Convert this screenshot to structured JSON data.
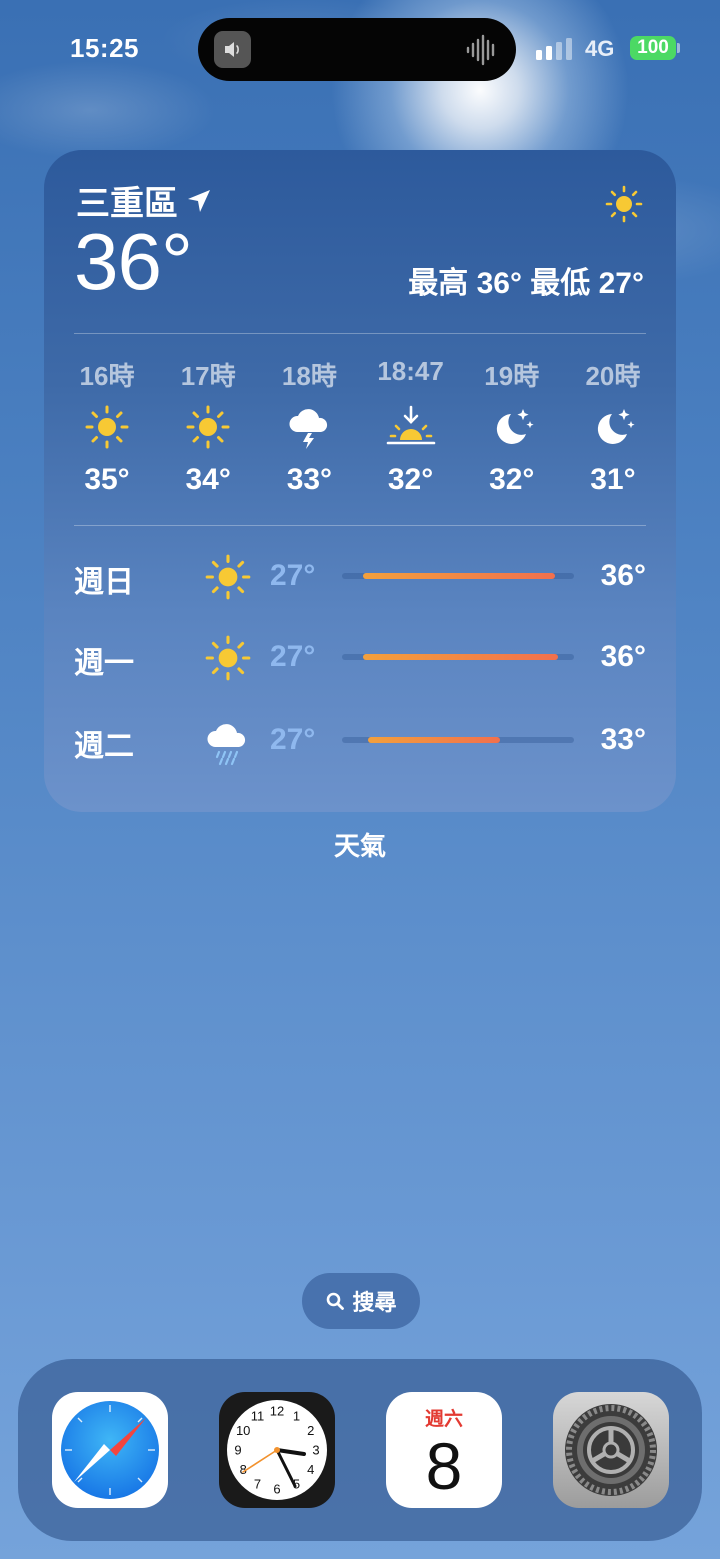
{
  "status_bar": {
    "time": "15:25",
    "network": "4G",
    "battery": "100"
  },
  "weather_widget": {
    "location": "三重區",
    "current_temp": "36°",
    "high_low": "最高 36° 最低 27°",
    "hourly": [
      {
        "time": "16時",
        "icon": "sun-icon",
        "temp": "35°"
      },
      {
        "time": "17時",
        "icon": "sun-icon",
        "temp": "34°"
      },
      {
        "time": "18時",
        "icon": "thunderstorm-icon",
        "temp": "33°"
      },
      {
        "time": "18:47",
        "icon": "sunset-icon",
        "temp": "32°"
      },
      {
        "time": "19時",
        "icon": "moon-stars-icon",
        "temp": "32°"
      },
      {
        "time": "20時",
        "icon": "moon-stars-icon",
        "temp": "31°"
      }
    ],
    "daily": [
      {
        "day": "週日",
        "icon": "sun-icon",
        "low": "27°",
        "high": "36°",
        "range_start": 0.09,
        "range_end": 0.92
      },
      {
        "day": "週一",
        "icon": "sun-icon",
        "low": "27°",
        "high": "36°",
        "range_start": 0.09,
        "range_end": 0.93
      },
      {
        "day": "週二",
        "icon": "rain-cloud-icon",
        "low": "27°",
        "high": "33°",
        "range_start": 0.11,
        "range_end": 0.68
      }
    ],
    "widget_label": "天氣"
  },
  "search": {
    "label": "搜尋"
  },
  "dock": {
    "apps": [
      "safari",
      "clock",
      "calendar",
      "settings"
    ],
    "calendar": {
      "weekday": "週六",
      "date": "8"
    },
    "clock_numbers": [
      "12",
      "1",
      "2",
      "3",
      "4",
      "5",
      "6",
      "7",
      "8",
      "9",
      "10",
      "11"
    ]
  },
  "colors": {
    "sun": "#f7c934",
    "battery": "#4cd964",
    "bar": "#f2704d",
    "low_temp": "#8fb8ee",
    "calendar_weekday": "#e33a32"
  }
}
